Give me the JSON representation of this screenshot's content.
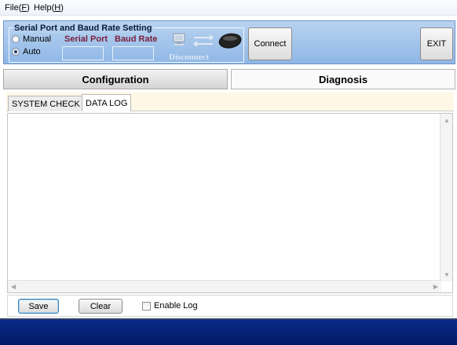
{
  "menu": {
    "file": {
      "label": "File(",
      "accel": "F",
      "tail": ")"
    },
    "help": {
      "label": "Help(",
      "accel": "H",
      "tail": ")"
    }
  },
  "serial": {
    "group_title": "Serial Port and Baud Rate Setting",
    "manual_label": "Manual",
    "auto_label": "Auto",
    "selected_mode": "Auto",
    "serial_port_label": "Serial Port",
    "baud_rate_label": "Baud Rate",
    "serial_port_value": "",
    "baud_rate_value": "",
    "disconnect_label": "Disconnect"
  },
  "buttons": {
    "connect": "Connect",
    "exit": "EXIT"
  },
  "tabs": [
    {
      "label": "Configuration",
      "active": false
    },
    {
      "label": "Diagnosis",
      "active": true
    }
  ],
  "subtabs": [
    {
      "label": "SYSTEM CHECK",
      "active": false
    },
    {
      "label": "DATA LOG",
      "active": true
    }
  ],
  "log": {
    "content": ""
  },
  "controls": {
    "save": "Save",
    "clear": "Clear",
    "enable_log": "Enable Log",
    "enable_log_checked": false
  },
  "colors": {
    "panel_top": "#b9d3f0",
    "panel_bottom": "#8eb7e6",
    "port_label": "#7a1e3a",
    "footer": "#0c2a88"
  },
  "icons": [
    "computer-icon",
    "transfer-arrows-icon",
    "device-icon"
  ]
}
